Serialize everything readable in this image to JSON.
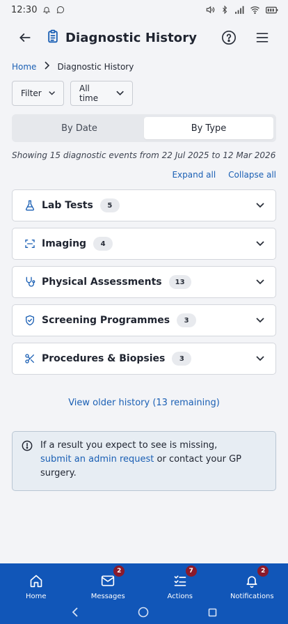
{
  "status_bar": {
    "time": "12:30"
  },
  "header": {
    "title": "Diagnostic History"
  },
  "breadcrumb": {
    "home": "Home",
    "current": "Diagnostic History"
  },
  "filters": {
    "filter_label": "Filter",
    "time_label": "All time"
  },
  "tabs": [
    {
      "label": "By Date",
      "active": false
    },
    {
      "label": "By Type",
      "active": true
    }
  ],
  "summary": "Showing 15 diagnostic events from 22 Jul 2025 to 12 Mar 2026",
  "controls": {
    "expand_all": "Expand all",
    "collapse_all": "Collapse all"
  },
  "categories": [
    {
      "label": "Lab Tests",
      "count": "5",
      "icon": "flask-icon"
    },
    {
      "label": "Imaging",
      "count": "4",
      "icon": "scan-icon"
    },
    {
      "label": "Physical Assessments",
      "count": "13",
      "icon": "stethoscope-icon"
    },
    {
      "label": "Screening Programmes",
      "count": "3",
      "icon": "shield-check-icon"
    },
    {
      "label": "Procedures & Biopsies",
      "count": "3",
      "icon": "scissors-icon"
    }
  ],
  "older_history": "View older history (13 remaining)",
  "info": {
    "text_before": "If a result you expect to see is missing,",
    "link": "submit an admin request",
    "text_after": " or contact your GP surgery."
  },
  "bottom_nav": [
    {
      "label": "Home",
      "badge": "",
      "icon": "home-icon"
    },
    {
      "label": "Messages",
      "badge": "2",
      "icon": "mail-icon"
    },
    {
      "label": "Actions",
      "badge": "7",
      "icon": "checklist-icon"
    },
    {
      "label": "Notifications",
      "badge": "2",
      "icon": "bell-icon"
    }
  ],
  "colors": {
    "accent": "#1a5fb4",
    "nav_bg": "#1156b8",
    "badge": "#8b1a2b"
  }
}
